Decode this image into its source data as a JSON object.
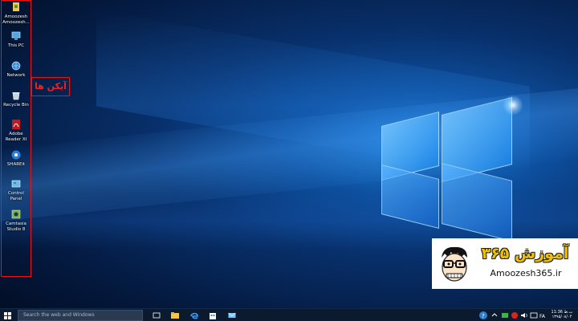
{
  "desktop": {
    "icons": [
      {
        "label": "Amoozesh Amoozesh...",
        "icon": "folder-icon"
      },
      {
        "label": "This PC",
        "icon": "computer-icon"
      },
      {
        "label": "Network",
        "icon": "network-icon"
      },
      {
        "label": "Recycle Bin",
        "icon": "recycle-bin-icon"
      },
      {
        "label": "Adobe Reader XI",
        "icon": "pdf-icon"
      },
      {
        "label": "SHAREit",
        "icon": "shareit-icon"
      },
      {
        "label": "Control Panel",
        "icon": "control-panel-icon"
      },
      {
        "label": "Camtasia Studio 8",
        "icon": "camtasia-icon"
      }
    ],
    "callout_text": "آیکن ها"
  },
  "promo": {
    "brand_text": "آموزش ۳۶۵",
    "site_text": "Amoozesh365.ir"
  },
  "taskbar": {
    "search_placeholder": "Search the web and Windows",
    "apps": [
      "task-view-icon",
      "file-explorer-icon",
      "edge-icon",
      "store-icon",
      "mail-icon"
    ],
    "time": "11:36 ب.ظ",
    "date": "۱۳۹۵/۰۸/۰۴"
  },
  "colors": {
    "annotation": "#e11111",
    "brand_yellow": "#f0c000",
    "taskbar_bg": "#0b1a2e"
  }
}
